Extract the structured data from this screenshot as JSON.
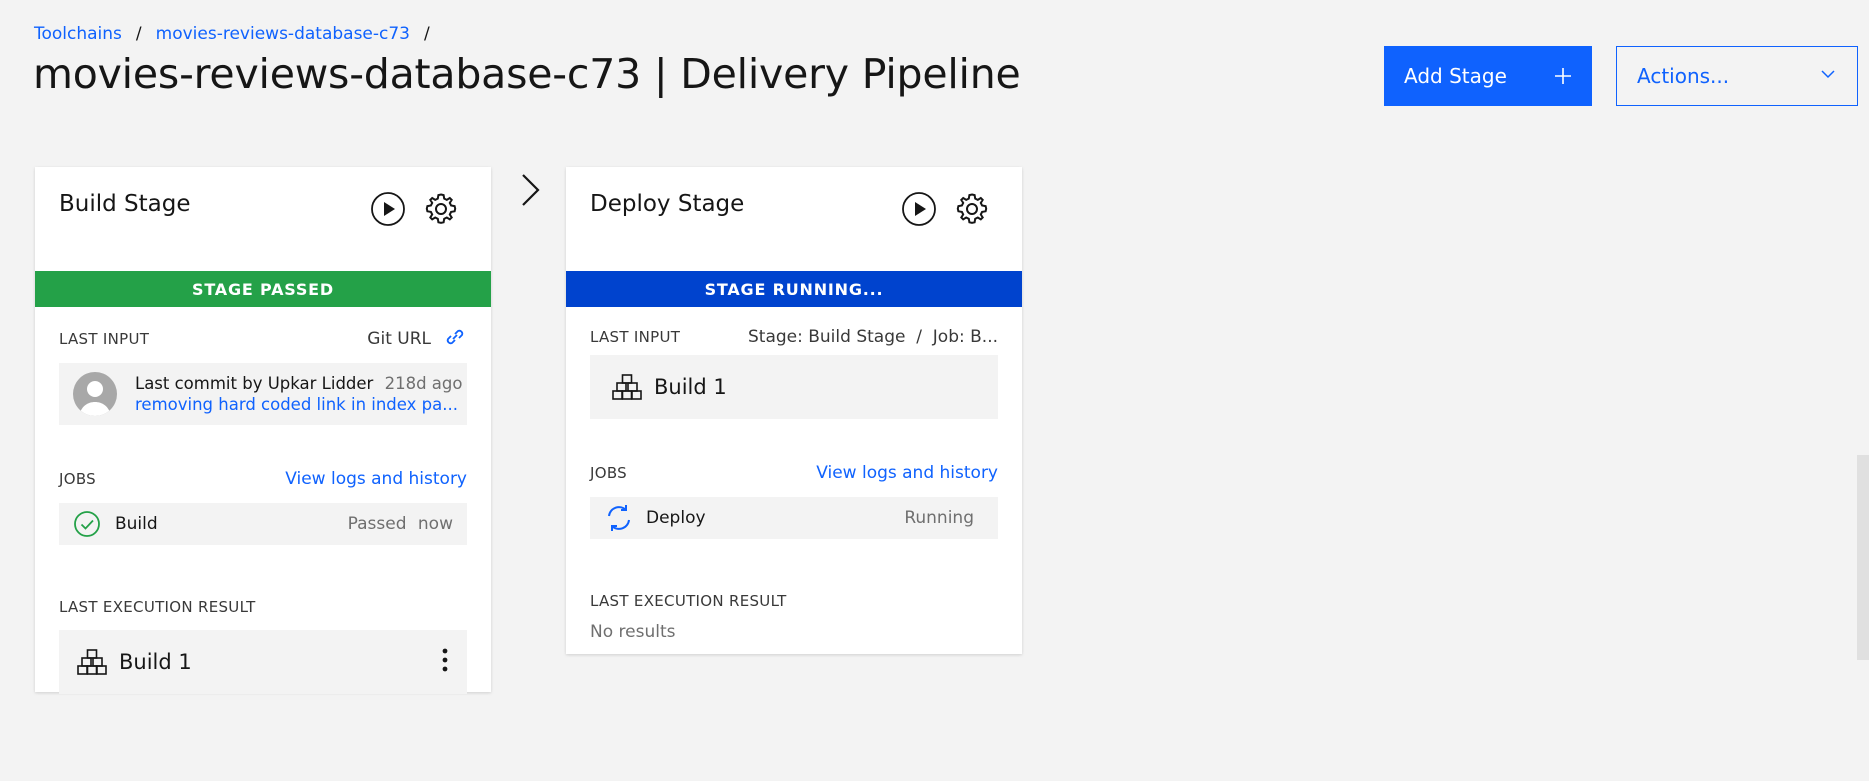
{
  "breadcrumb": {
    "items": [
      "Toolchains",
      "movies-reviews-database-c73"
    ],
    "separator": "/"
  },
  "page": {
    "title": "movies-reviews-database-c73 | Delivery Pipeline"
  },
  "toolbar": {
    "add_stage_label": "Add Stage",
    "actions_label": "Actions..."
  },
  "colors": {
    "primary": "#0f62fe",
    "passed": "#24a148",
    "running": "#0043ce"
  },
  "stages": [
    {
      "title": "Build Stage",
      "status": "STAGE PASSED",
      "last_input": {
        "label": "LAST INPUT",
        "source": "Git URL",
        "commit_by": "Last commit by Upkar Lidder",
        "commit_age": "218d ago",
        "commit_message": "removing hard coded link in index pa..."
      },
      "jobs": {
        "label": "JOBS",
        "logs_link": "View logs and history",
        "items": [
          {
            "name": "Build",
            "status": "Passed",
            "time": "now",
            "icon": "checkmark-outline-icon"
          }
        ]
      },
      "last_execution": {
        "label": "LAST EXECUTION RESULT",
        "result": "Build 1"
      }
    },
    {
      "title": "Deploy Stage",
      "status": "STAGE RUNNING...",
      "last_input": {
        "label": "LAST INPUT",
        "source": "Stage: Build Stage  /  Job: B...",
        "result": "Build 1"
      },
      "jobs": {
        "label": "JOBS",
        "logs_link": "View logs and history",
        "items": [
          {
            "name": "Deploy",
            "status": "Running",
            "icon": "renew-icon"
          }
        ]
      },
      "last_execution": {
        "label": "LAST EXECUTION RESULT",
        "result": "No results"
      }
    }
  ]
}
